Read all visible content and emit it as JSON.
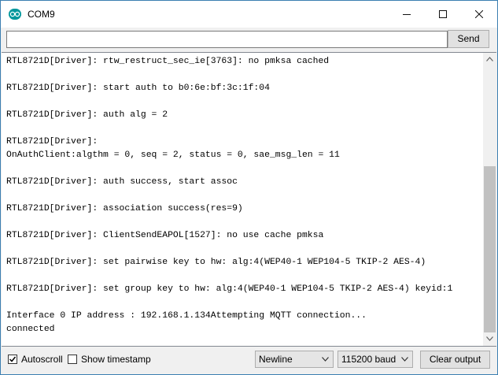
{
  "window": {
    "title": "COM9",
    "app_icon": "arduino-logo-icon",
    "accent": "#00979c"
  },
  "send_bar": {
    "input_value": "",
    "send_label": "Send"
  },
  "output": {
    "lines": [
      "RTL8721D[Driver]: rtw_restruct_sec_ie[3763]: no pmksa cached",
      "",
      "RTL8721D[Driver]: start auth to b0:6e:bf:3c:1f:04",
      "",
      "RTL8721D[Driver]: auth alg = 2",
      "",
      "RTL8721D[Driver]:",
      "OnAuthClient:algthm = 0, seq = 2, status = 0, sae_msg_len = 11",
      "",
      "RTL8721D[Driver]: auth success, start assoc",
      "",
      "RTL8721D[Driver]: association success(res=9)",
      "",
      "RTL8721D[Driver]: ClientSendEAPOL[1527]: no use cache pmksa",
      "",
      "RTL8721D[Driver]: set pairwise key to hw: alg:4(WEP40-1 WEP104-5 TKIP-2 AES-4)",
      "",
      "RTL8721D[Driver]: set group key to hw: alg:4(WEP40-1 WEP104-5 TKIP-2 AES-4) keyid:1",
      "",
      "Interface 0 IP address : 192.168.1.134Attempting MQTT connection...",
      "connected"
    ]
  },
  "footer": {
    "autoscroll_label": "Autoscroll",
    "autoscroll_checked": true,
    "timestamp_label": "Show timestamp",
    "timestamp_checked": false,
    "line_ending": "Newline",
    "baud_rate": "115200 baud",
    "clear_label": "Clear output"
  }
}
